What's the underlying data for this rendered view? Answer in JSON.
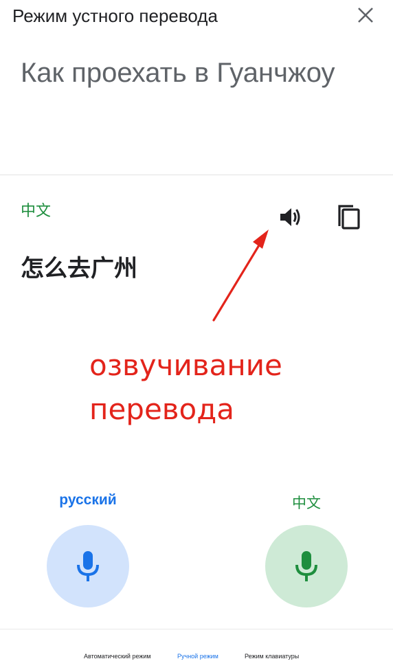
{
  "header": {
    "title": "Режим устного перевода",
    "close_icon": "close-icon"
  },
  "source": {
    "text": "Как проехать в Гуанчжоу"
  },
  "translation": {
    "language": "中文",
    "text": "怎么去广州",
    "speak_icon": "volume-up-icon",
    "copy_icon": "copy-icon"
  },
  "annotation": {
    "line1": "озвучивание",
    "line2": "перевода",
    "color": "#e3241b"
  },
  "languages": {
    "left": {
      "label": "русский",
      "color": "#1a73e8",
      "mic_bg": "#d2e3fc"
    },
    "right": {
      "label": "中文",
      "color": "#1e8e3e",
      "mic_bg": "#ceead6"
    }
  },
  "modes": {
    "auto": "Автоматический режим",
    "manual": "Ручной режим",
    "keyboard": "Режим клавиатуры",
    "active": "manual"
  }
}
